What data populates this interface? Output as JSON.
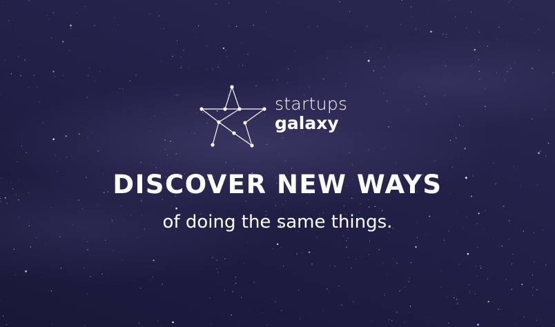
{
  "brand": {
    "word_1": "startups",
    "word_2": "galaxy",
    "logo_icon": "star-constellation-icon"
  },
  "hero": {
    "headline": "DISCOVER NEW WAYS",
    "tagline": "of doing the same things."
  },
  "colors": {
    "background": "#23224a",
    "text": "#ffffff",
    "stars": "#ffffff"
  }
}
